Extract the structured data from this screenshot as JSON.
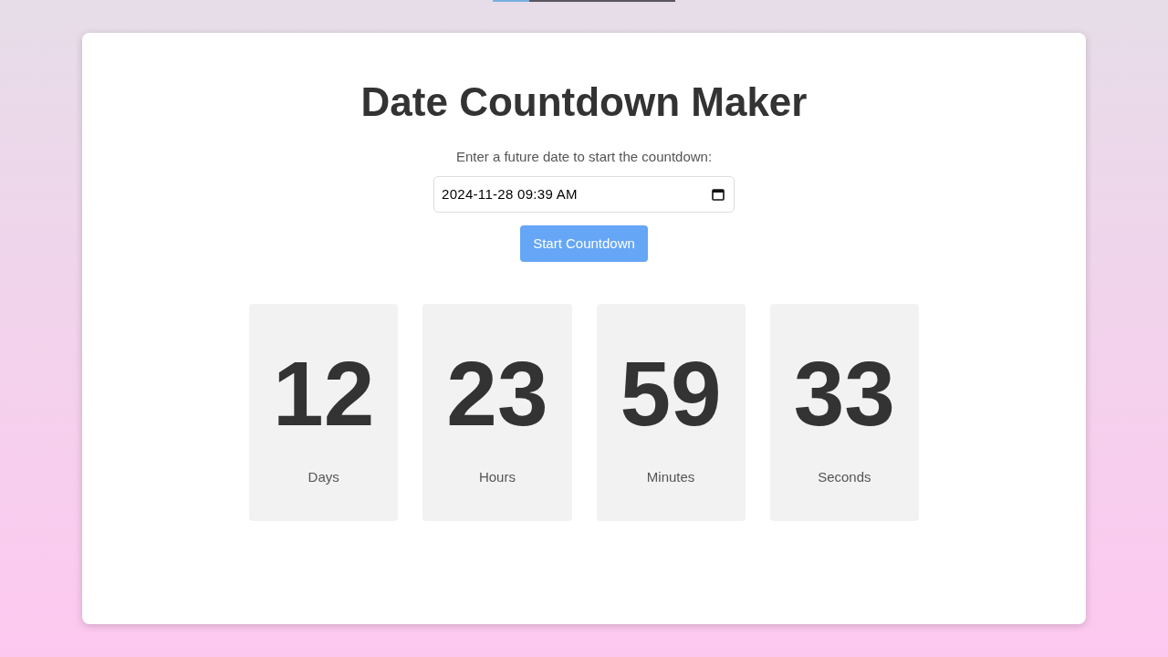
{
  "progress": {
    "level": 0.2
  },
  "title": "Date Countdown Maker",
  "prompt": "Enter a future date to start the countdown:",
  "date_input": {
    "value": "2024-11-28 09:39 AM"
  },
  "start_button": {
    "label": "Start Countdown"
  },
  "countdown": [
    {
      "value": "12",
      "unit": "Days"
    },
    {
      "value": "23",
      "unit": "Hours"
    },
    {
      "value": "59",
      "unit": "Minutes"
    },
    {
      "value": "33",
      "unit": "Seconds"
    }
  ]
}
